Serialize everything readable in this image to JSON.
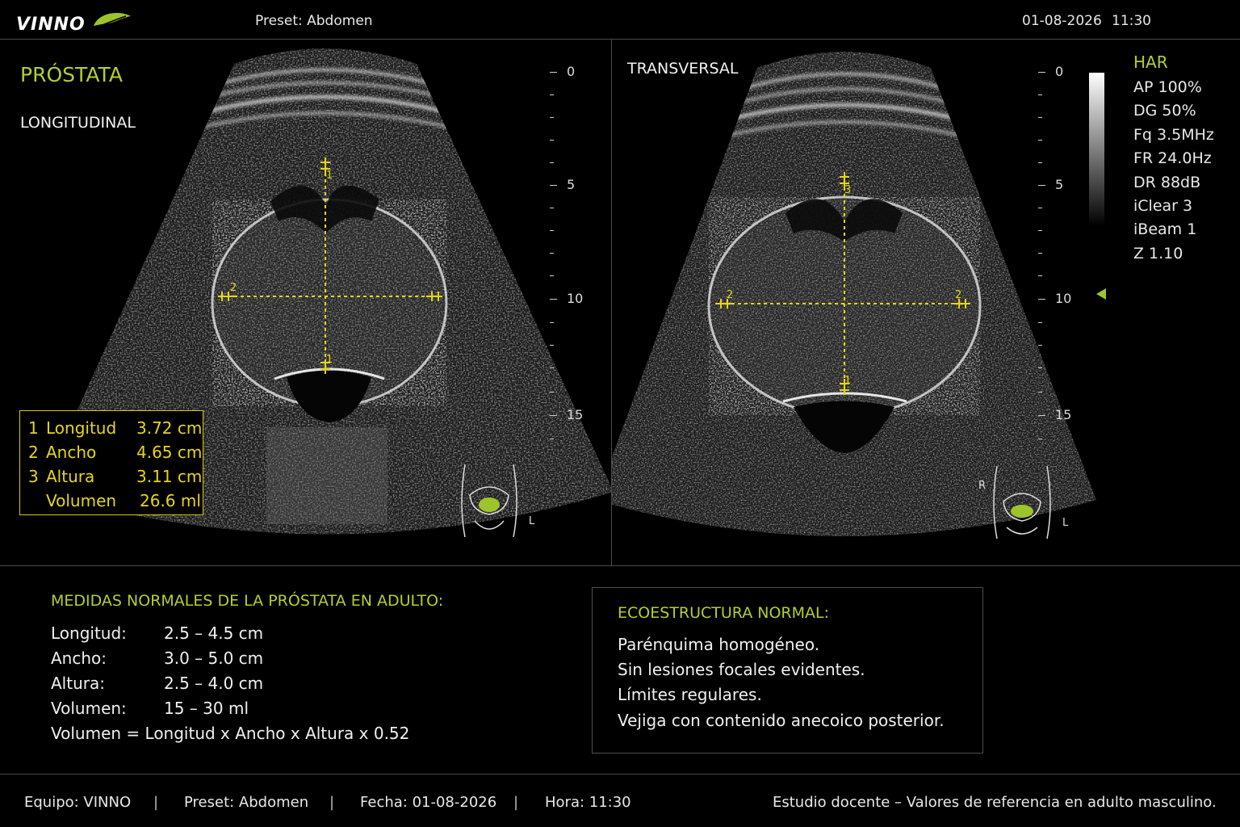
{
  "header": {
    "logo": "VINNO",
    "preset": "Preset: Abdomen",
    "date": "01-08-2026",
    "time": "11:30"
  },
  "left_panel": {
    "title": "PRÓSTATA",
    "view": "LONGITUDINAL",
    "depth_labels": [
      "0",
      "5",
      "10",
      "15"
    ],
    "caliper_labels": [
      "1",
      "1",
      "2"
    ],
    "measurements": [
      {
        "index": "1",
        "name": "Longitud",
        "value": "3.72 cm"
      },
      {
        "index": "2",
        "name": "Ancho",
        "value": "4.65 cm"
      },
      {
        "index": "3",
        "name": "Altura",
        "value": "3.11 cm"
      },
      {
        "index": "",
        "name": "Volumen",
        "value": "26.6  ml"
      }
    ],
    "body_marker_side": "L"
  },
  "right_panel": {
    "view": "TRANSVERSAL",
    "depth_labels": [
      "0",
      "5",
      "10",
      "15"
    ],
    "caliper_labels": [
      "3",
      "2",
      "2",
      "1"
    ],
    "body_marker_left": "R",
    "body_marker_right": "L"
  },
  "params": {
    "title": "HAR",
    "items": [
      "AP  100%",
      "DG  50%",
      "Fq  3.5MHz",
      "FR  24.0Hz",
      "DR  88dB",
      "iClear  3",
      "iBeam  1",
      "Z  1.10"
    ]
  },
  "normal_measures": {
    "title": "MEDIDAS NORMALES DE LA PRÓSTATA EN ADULTO:",
    "rows": [
      {
        "label": "Longitud:",
        "value": "2.5 – 4.5 cm"
      },
      {
        "label": "Ancho:",
        "value": "3.0 – 5.0 cm"
      },
      {
        "label": "Altura:",
        "value": "2.5 – 4.0 cm"
      },
      {
        "label": "Volumen:",
        "value": "15 – 30 ml"
      }
    ],
    "formula": "Volumen = Longitud x Ancho x Altura x 0.52"
  },
  "echostructure": {
    "title": "ECOESTRUCTURA NORMAL:",
    "lines": [
      "Parénquima homogéneo.",
      "Sin lesiones focales evidentes.",
      "Límites regulares.",
      "Vejiga con contenido anecoico posterior."
    ]
  },
  "footer": {
    "equipment": "Equipo:  VINNO",
    "preset": "Preset:  Abdomen",
    "date": "Fecha:  01-08-2026",
    "time": "Hora:  11:30",
    "note": "Estudio docente – Valores de referencia en adulto masculino.",
    "separator": "|"
  },
  "colors": {
    "accent_green": "#b3cf2e",
    "caliper_yellow": "#e6d619",
    "divider": "#4a4a4a"
  }
}
